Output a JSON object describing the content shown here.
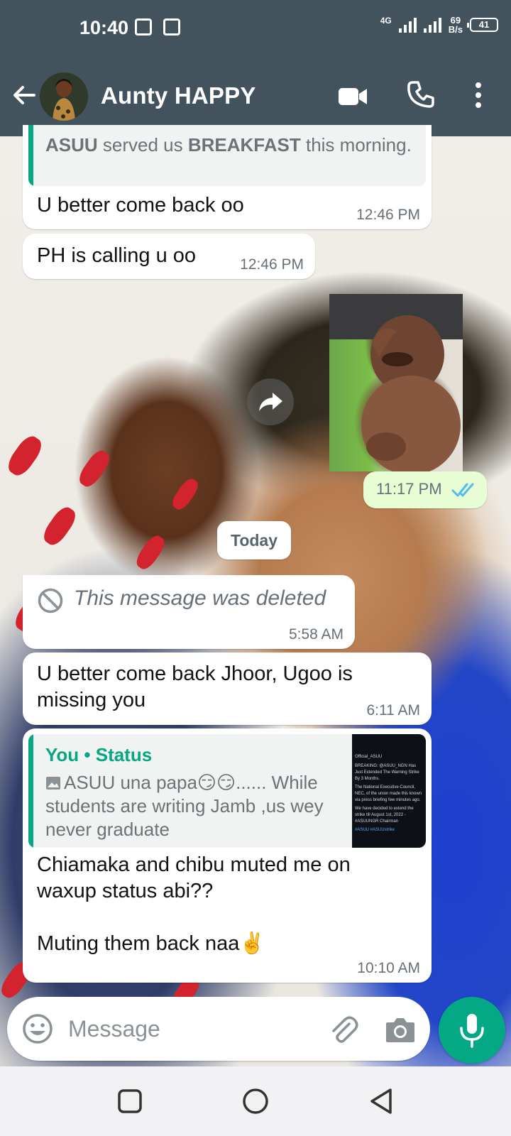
{
  "status_bar": {
    "time": "10:40",
    "net_type": "4G",
    "net_speed_value": "69",
    "net_speed_unit": "B/s",
    "battery": "41"
  },
  "header": {
    "contact_name": "Aunty HAPPY"
  },
  "messages": {
    "m1": {
      "quote_bold1": "ASUU",
      "quote_mid": " served us ",
      "quote_bold2": "BREAKFAST",
      "quote_end": " this morning.",
      "text": "U better come back oo",
      "time": "12:46 PM"
    },
    "m2": {
      "text": "PH is calling u oo",
      "time": "12:46 PM"
    },
    "m3": {
      "time": "11:17 PM"
    },
    "date_chip": "Today",
    "m4": {
      "text": "This message was deleted",
      "time": "5:58 AM"
    },
    "m5": {
      "text": "U better come back Jhoor, Ugoo is missing you",
      "time": "6:11 AM"
    },
    "m6": {
      "quote_author": "You • Status",
      "quote_text": "ASUU una papa😏😏...... While students are writing Jamb ,us wey never graduate",
      "thumb_lines": [
        "Official_ASUU",
        "BREAKING: @ASUU_NGN Has Just Extended The Warning Strike By 3 Months.",
        "The National Executive Council, NEC, of the union made this known via press briefing few minutes ago.",
        "We have decided to extend the strike till August 1st, 2022 - #ASUUNGR Chairman",
        "#ASUU #ASUUstrike"
      ],
      "text": "Chiamaka and chibu muted me on waxup status abi??\n\nMuting them back naa✌️",
      "time": "10:10 AM"
    }
  },
  "composer": {
    "placeholder": "Message"
  },
  "icons": {
    "back": "arrow-left-icon",
    "video": "video-camera-icon",
    "call": "phone-icon",
    "menu": "more-vertical-icon",
    "forward": "forward-icon",
    "read_receipt": "double-check-icon",
    "deleted": "prohibited-icon",
    "emoji": "emoji-icon",
    "attach": "paperclip-icon",
    "camera": "camera-icon",
    "mic": "microphone-icon"
  },
  "colors": {
    "header": "#42535d",
    "accent": "#05a884",
    "outgoing_bubble": "#e7fdd4",
    "read_tick": "#53bdeb"
  }
}
